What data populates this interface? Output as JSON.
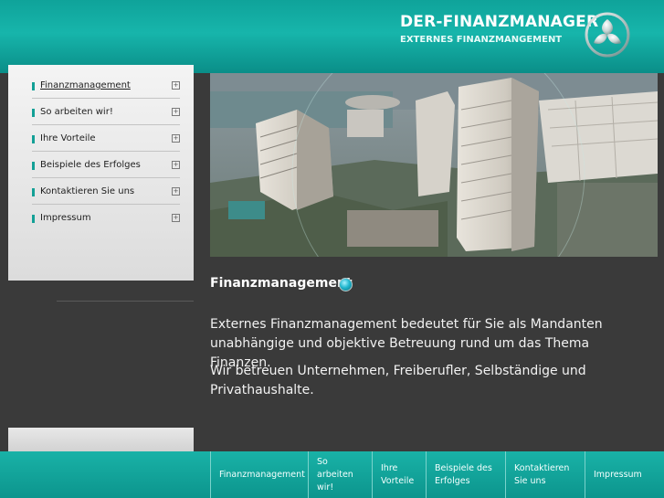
{
  "header": {
    "title": "DER-FINANZMANAGER",
    "subtitle": "EXTERNES FINANZMANGEMENT"
  },
  "sidebar": {
    "items": [
      {
        "label": "Finanzmanagement",
        "active": true
      },
      {
        "label": "So arbeiten wir!",
        "active": false
      },
      {
        "label": "Ihre Vorteile",
        "active": false
      },
      {
        "label": "Beispiele des Erfolges",
        "active": false
      },
      {
        "label": "Kontaktieren Sie uns",
        "active": false
      },
      {
        "label": "Impressum",
        "active": false
      }
    ],
    "expand_icon": "plus-box-icon"
  },
  "main": {
    "title": "Finanzmanagement",
    "paragraphs": [
      "Externes Finanzmanagement bedeutet für Sie als Mandanten unabhängige und objektive Betreuung rund um das Thema Finanzen.",
      "Wir betreuen Unternehmen, Freiberufler, Selbständige und Privathaushalte."
    ]
  },
  "footer": {
    "items": [
      {
        "lines": [
          "Finanzmanagement"
        ]
      },
      {
        "lines": [
          "So",
          "arbeiten",
          "wir!"
        ]
      },
      {
        "lines": [
          "Ihre",
          "Vorteile"
        ]
      },
      {
        "lines": [
          "Beispiele des",
          "Erfolges"
        ]
      },
      {
        "lines": [
          "Kontaktieren",
          "Sie uns"
        ]
      },
      {
        "lines": [
          "Impressum"
        ]
      }
    ]
  },
  "colors": {
    "accent": "#13a096",
    "background": "#3a3a3a",
    "sidebar": "#e8e8e8"
  }
}
